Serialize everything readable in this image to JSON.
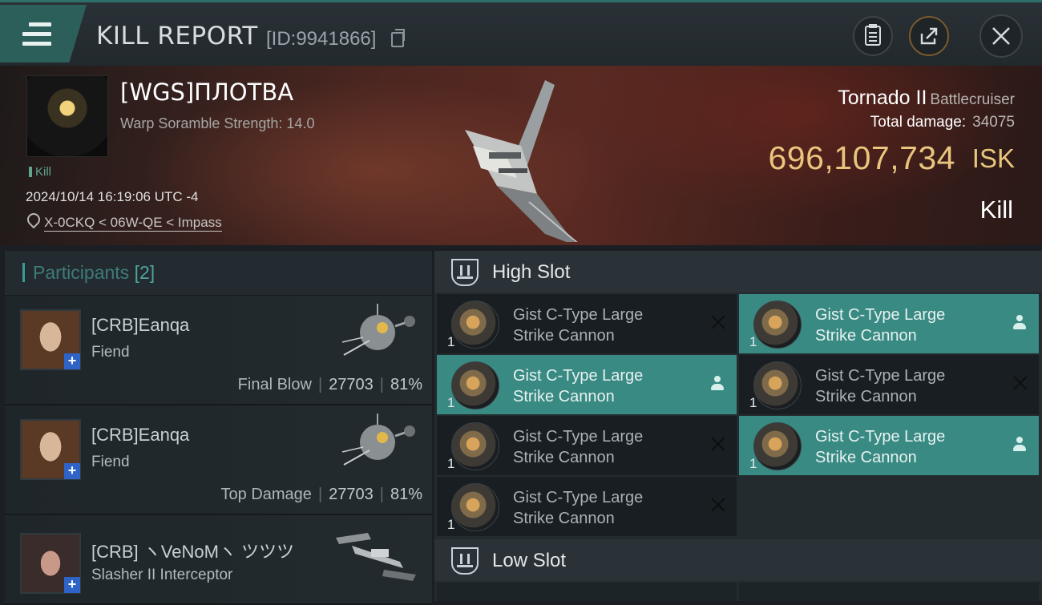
{
  "header": {
    "title": "KILL REPORT",
    "id_label": "[ID:9941866]",
    "icons": [
      "menu-icon",
      "copy-icon",
      "clipboard-icon",
      "share-icon",
      "close-icon"
    ],
    "accent_color": "#2d5f5a"
  },
  "victim": {
    "name": "[WGS]ПЛОТВА",
    "subtitle": "Warp Soramble Strength: 14.0",
    "tag": "Kill",
    "timestamp": "2024/10/14 16:19:06 UTC -4",
    "location": "X-0CKQ < 06W-QE < Impass",
    "ship_name": "Tornado II",
    "ship_class": "Battlecruiser",
    "total_damage_label": "Total damage:",
    "total_damage": "34075",
    "isk_value": "696,107,734",
    "isk_unit": "ISK",
    "result": "Kill",
    "isk_color": "#e9c57e"
  },
  "participants": {
    "label": "Participants",
    "count": "[2]",
    "items": [
      {
        "name": "[CRB]Eanqa",
        "ship": "Fiend",
        "stat_label": "Final Blow",
        "damage": "27703",
        "percent": "81%",
        "badge": "+"
      },
      {
        "name": "[CRB]Eanqa",
        "ship": "Fiend",
        "stat_label": "Top Damage",
        "damage": "27703",
        "percent": "81%",
        "badge": "+"
      },
      {
        "name": "[CRB] ヽVeNoMヽ ツツツ",
        "ship": "Slasher II Interceptor",
        "badge": "+"
      }
    ]
  },
  "slots": {
    "high_label": "High Slot",
    "low_label": "Low Slot",
    "high_items": [
      {
        "line1": "Gist C-Type Large",
        "line2": "Strike Cannon",
        "qty": "1",
        "status": "destroyed"
      },
      {
        "line1": "Gist C-Type Large",
        "line2": "Strike Cannon",
        "qty": "1",
        "status": "dropped"
      },
      {
        "line1": "Gist C-Type Large",
        "line2": "Strike Cannon",
        "qty": "1",
        "status": "dropped"
      },
      {
        "line1": "Gist C-Type Large",
        "line2": "Strike Cannon",
        "qty": "1",
        "status": "destroyed"
      },
      {
        "line1": "Gist C-Type Large",
        "line2": "Strike Cannon",
        "qty": "1",
        "status": "destroyed"
      },
      {
        "line1": "Gist C-Type Large",
        "line2": "Strike Cannon",
        "qty": "1",
        "status": "dropped"
      },
      {
        "line1": "Gist C-Type Large",
        "line2": "Strike Cannon",
        "qty": "1",
        "status": "destroyed"
      }
    ],
    "drop_color": "#3a8a84"
  }
}
